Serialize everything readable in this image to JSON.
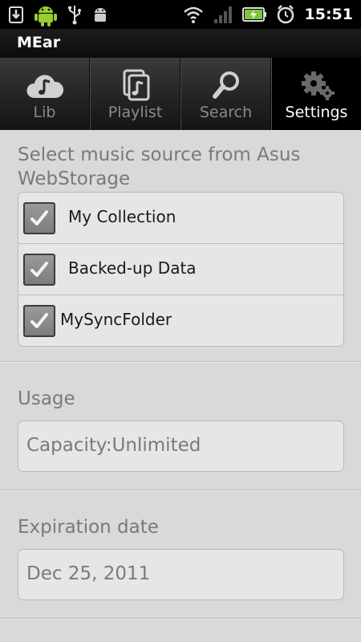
{
  "status_bar": {
    "time": "15:51",
    "icons": [
      "download-icon",
      "android-icon",
      "usb-icon",
      "android-debug-icon",
      "wifi-icon",
      "signal-icon",
      "battery-icon",
      "alarm-icon"
    ]
  },
  "app": {
    "title": "MEar"
  },
  "tabs": [
    {
      "label": "Lib",
      "icon": "cloud-music-icon",
      "active": false
    },
    {
      "label": "Playlist",
      "icon": "playlist-icon",
      "active": false
    },
    {
      "label": "Search",
      "icon": "search-icon",
      "active": false
    },
    {
      "label": "Settings",
      "icon": "gears-icon",
      "active": true
    }
  ],
  "source": {
    "heading": "Select music source from Asus WebStorage",
    "options": [
      {
        "label": "My Collection",
        "checked": true
      },
      {
        "label": "Backed-up Data",
        "checked": true
      },
      {
        "label": "MySyncFolder",
        "checked": true
      }
    ]
  },
  "usage": {
    "heading": "Usage",
    "value": "Capacity:Unlimited"
  },
  "expiration": {
    "heading": "Expiration date",
    "value": "Dec 25, 2011"
  }
}
